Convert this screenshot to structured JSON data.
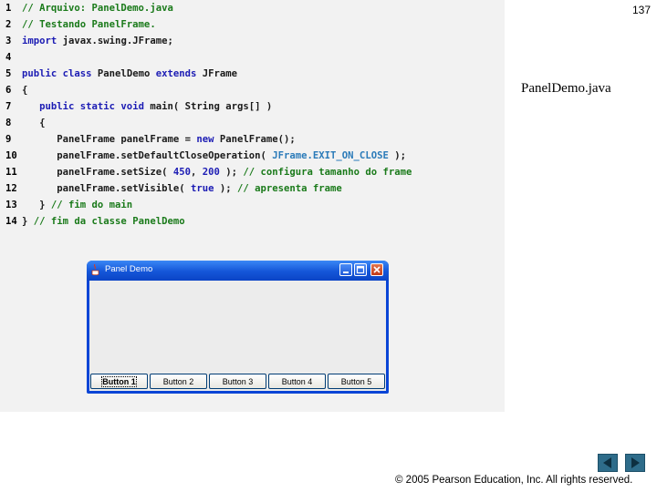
{
  "slide": {
    "page_number": "137",
    "file_label": "PanelDemo.java",
    "copyright": "© 2005 Pearson Education, Inc.  All rights reserved."
  },
  "code_lines": [
    {
      "num": "1",
      "tokens": [
        {
          "t": "// Arquivo: PanelDemo.java",
          "c": "comment"
        }
      ]
    },
    {
      "num": "2",
      "tokens": [
        {
          "t": "// Testando PanelFrame.",
          "c": "comment"
        }
      ]
    },
    {
      "num": "3",
      "tokens": [
        {
          "t": "import",
          "c": "kw"
        },
        {
          "t": " javax.swing.JFrame;",
          "c": "default"
        }
      ]
    },
    {
      "num": "4",
      "tokens": []
    },
    {
      "num": "5",
      "tokens": [
        {
          "t": "public class",
          "c": "kw"
        },
        {
          "t": " PanelDemo ",
          "c": "default"
        },
        {
          "t": "extends",
          "c": "kw"
        },
        {
          "t": " JFrame",
          "c": "default"
        }
      ]
    },
    {
      "num": "6",
      "tokens": [
        {
          "t": "{",
          "c": "default"
        }
      ]
    },
    {
      "num": "7",
      "tokens": [
        {
          "t": "   ",
          "c": "default"
        },
        {
          "t": "public static void",
          "c": "kw"
        },
        {
          "t": " main( String args[] )",
          "c": "default"
        }
      ]
    },
    {
      "num": "8",
      "tokens": [
        {
          "t": "   {",
          "c": "default"
        }
      ]
    },
    {
      "num": "9",
      "tokens": [
        {
          "t": "      PanelFrame panelFrame = ",
          "c": "default"
        },
        {
          "t": "new",
          "c": "kw"
        },
        {
          "t": " PanelFrame();",
          "c": "default"
        }
      ]
    },
    {
      "num": "10",
      "tokens": [
        {
          "t": "      panelFrame.setDefaultCloseOperation( ",
          "c": "default"
        },
        {
          "t": "JFrame.EXIT_ON_CLOSE",
          "c": "const"
        },
        {
          "t": " );",
          "c": "default"
        }
      ]
    },
    {
      "num": "11",
      "tokens": [
        {
          "t": "      panelFrame.setSize( ",
          "c": "default"
        },
        {
          "t": "450",
          "c": "num"
        },
        {
          "t": ", ",
          "c": "default"
        },
        {
          "t": "200",
          "c": "num"
        },
        {
          "t": " ); ",
          "c": "default"
        },
        {
          "t": "// configura tamanho do frame",
          "c": "comment"
        }
      ]
    },
    {
      "num": "12",
      "tokens": [
        {
          "t": "      panelFrame.setVisible( ",
          "c": "default"
        },
        {
          "t": "true",
          "c": "kw"
        },
        {
          "t": " ); ",
          "c": "default"
        },
        {
          "t": "// apresenta frame",
          "c": "comment"
        }
      ]
    },
    {
      "num": "13",
      "tokens": [
        {
          "t": "   } ",
          "c": "default"
        },
        {
          "t": "// fim do main",
          "c": "comment"
        }
      ]
    },
    {
      "num": "14",
      "tokens": [
        {
          "t": "} ",
          "c": "default"
        },
        {
          "t": "// fim da classe PanelDemo",
          "c": "comment"
        }
      ]
    }
  ],
  "window": {
    "title": "Panel Demo",
    "buttons": [
      "Button 1",
      "Button 2",
      "Button 3",
      "Button 4",
      "Button 5"
    ],
    "focused_button": "Button 1"
  },
  "colors": {
    "keyword": "#1c1cb4",
    "comment": "#1a7a1a",
    "constant": "#2b7bb9",
    "nav_button": "#2e6c8a"
  },
  "icons": {
    "window_icon": "java-cup-icon",
    "minimize": "minimize-icon",
    "maximize": "maximize-icon",
    "close": "close-icon",
    "prev": "arrow-left-icon",
    "next": "arrow-right-icon"
  }
}
